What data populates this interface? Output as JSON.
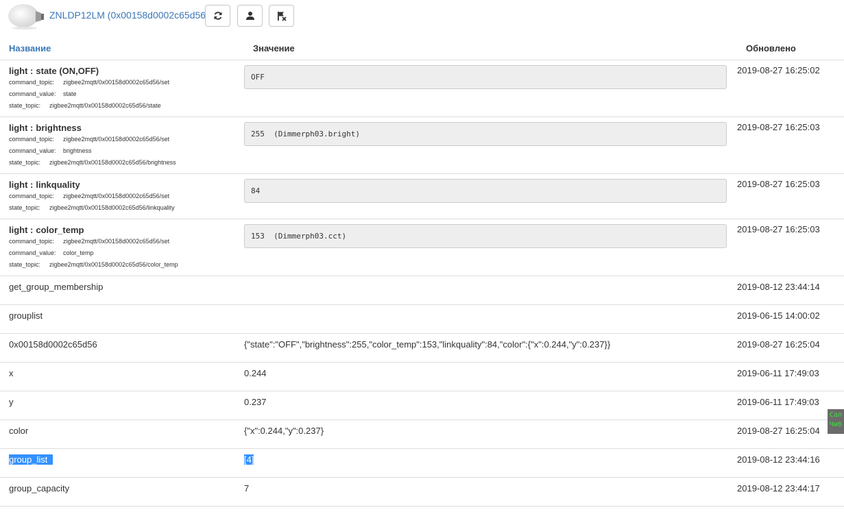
{
  "header": {
    "device_title": "ZNLDP12LM (0x00158d0002c65d56)",
    "buttons": [
      {
        "icon": "refresh-icon"
      },
      {
        "icon": "user-icon"
      },
      {
        "icon": "flag-remove-icon"
      }
    ]
  },
  "table": {
    "columns": {
      "name": "Название",
      "value": "Значение",
      "updated": "Обновлено"
    },
    "rows": [
      {
        "prefix": "light :",
        "name": "state (ON,OFF)",
        "meta": [
          {
            "key": "command_topic:",
            "value": "zigbee2mqtt/0x00158d0002c65d56/set"
          },
          {
            "key": "command_value:",
            "value": "state"
          },
          {
            "key": "state_topic:",
            "value": "zigbee2mqtt/0x00158d0002c65d56/state"
          }
        ],
        "value": "OFF",
        "updated": "2019-08-27 16:25:02"
      },
      {
        "prefix": "light :",
        "name": "brightness",
        "meta": [
          {
            "key": "command_topic:",
            "value": "zigbee2mqtt/0x00158d0002c65d56/set"
          },
          {
            "key": "command_value:",
            "value": "brightness"
          },
          {
            "key": "state_topic:",
            "value": "zigbee2mqtt/0x00158d0002c65d56/brightness"
          }
        ],
        "value": "255  (Dimmerph03.bright)",
        "updated": "2019-08-27 16:25:03"
      },
      {
        "prefix": "light :",
        "name": "linkquality",
        "meta": [
          {
            "key": "command_topic:",
            "value": "zigbee2mqtt/0x00158d0002c65d56/set"
          },
          {
            "key": "state_topic:",
            "value": "zigbee2mqtt/0x00158d0002c65d56/linkquality"
          }
        ],
        "value": "84",
        "updated": "2019-08-27 16:25:03"
      },
      {
        "prefix": "light :",
        "name": "color_temp",
        "meta": [
          {
            "key": "command_topic:",
            "value": "zigbee2mqtt/0x00158d0002c65d56/set"
          },
          {
            "key": "command_value:",
            "value": "color_temp"
          },
          {
            "key": "state_topic:",
            "value": "zigbee2mqtt/0x00158d0002c65d56/color_temp"
          }
        ],
        "value": "153  (Dimmerph03.cct)",
        "updated": "2019-08-27 16:25:03"
      }
    ],
    "simple_rows": [
      {
        "name": "get_group_membership",
        "value": "",
        "updated": "2019-08-12 23:44:14"
      },
      {
        "name": "grouplist",
        "value": "",
        "updated": "2019-06-15 14:00:02"
      },
      {
        "name": "0x00158d0002c65d56",
        "value": "{\"state\":\"OFF\",\"brightness\":255,\"color_temp\":153,\"linkquality\":84,\"color\":{\"x\":0.244,\"y\":0.237}}",
        "updated": "2019-08-27 16:25:04"
      },
      {
        "name": "x",
        "value": "0.244",
        "updated": "2019-06-11 17:49:03"
      },
      {
        "name": "y",
        "value": "0.237",
        "updated": "2019-06-11 17:49:03"
      },
      {
        "name": "color",
        "value": "{\"x\":0.244,\"y\":0.237}",
        "updated": "2019-08-27 16:25:04"
      },
      {
        "name": "group_list",
        "value": "[4]",
        "updated": "2019-08-12 23:44:16",
        "selected": true
      },
      {
        "name": "group_capacity",
        "value": "7",
        "updated": "2019-08-12 23:44:17"
      }
    ]
  },
  "side_widget": {
    "line1": "Сал",
    "line2": "Чиб"
  },
  "colors": {
    "link": "#3b77b7",
    "selection": "#3390ff",
    "value_box_bg": "#eeeeee",
    "border": "#dddddd"
  }
}
